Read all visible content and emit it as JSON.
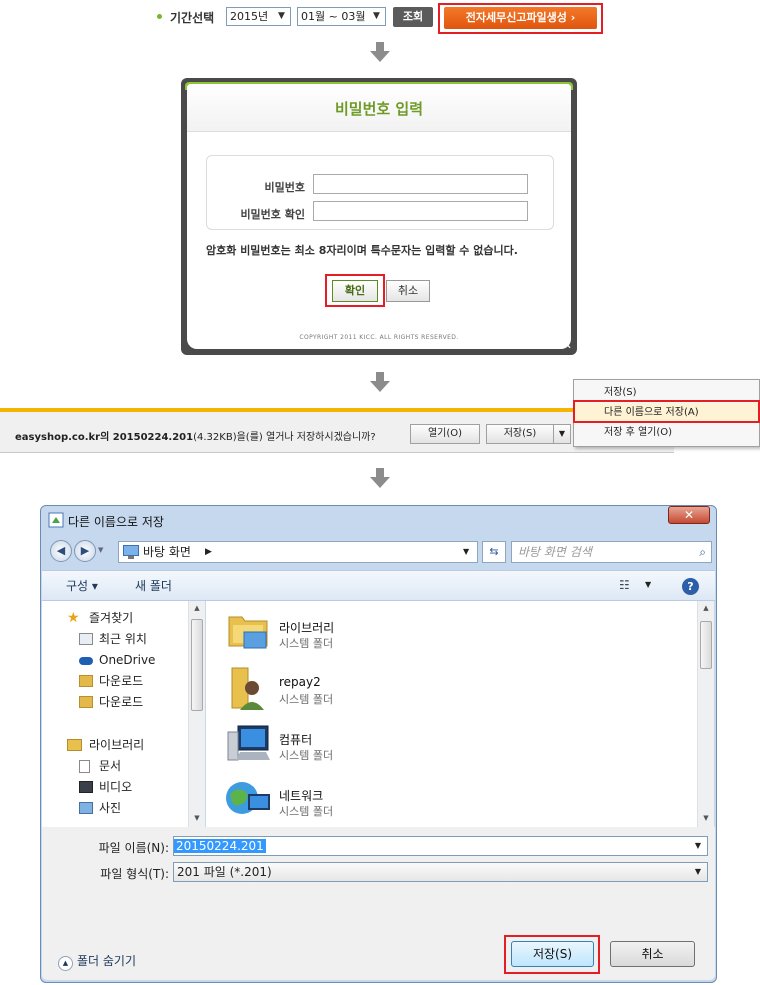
{
  "period_bar": {
    "label": "기간선택",
    "year": "2015년",
    "months": "01월 ~ 03월",
    "search_button": "조회",
    "generate_button": "전자세무신고파일생성 ›"
  },
  "password_dialog": {
    "title": "비밀번호 입력",
    "password_label": "비밀번호",
    "confirm_label": "비밀번호 확인",
    "note": "암호화 비밀번호는 최소 8자리이며 특수문자는 입력할 수 없습니다.",
    "ok_button": "확인",
    "cancel_button": "취소",
    "copyright": "COPYRIGHT 2011 KICC. ALL RIGHTS RESERVED.",
    "close_label": "✕"
  },
  "download_bar": {
    "message_part1": "easyshop.co.kr의 20150224.201",
    "message_part2": "(4.32KB)",
    "message_part3": "을(를) 열거나 저장하시겠습니까?",
    "open_button": "열기(O)",
    "save_button": "저장(S)",
    "menu": [
      "저장(S)",
      "다른 이름으로 저장(A)",
      "저장 후 열기(O)"
    ]
  },
  "save_dialog": {
    "title": "다른 이름으로 저장",
    "address": "바탕 화면",
    "search_placeholder": "바탕 화면 검색",
    "organize": "구성 ▾",
    "new_folder": "새 폴더",
    "nav": {
      "favorites": "즐겨찾기",
      "recent": "최근 위치",
      "onedrive": "OneDrive",
      "downloads1": "다운로드",
      "downloads2": "다운로드",
      "libraries": "라이브러리",
      "documents": "문서",
      "videos": "비디오",
      "pictures": "사진"
    },
    "files": [
      {
        "name": "라이브러리",
        "type": "시스템 폴더"
      },
      {
        "name": "repay2",
        "type": "시스템 폴더"
      },
      {
        "name": "컴퓨터",
        "type": "시스템 폴더"
      },
      {
        "name": "네트워크",
        "type": "시스템 폴더"
      }
    ],
    "filename_label": "파일 이름(N):",
    "filename_value": "20150224.201",
    "filetype_label": "파일 형식(T):",
    "filetype_value": "201 파일 (*.201)",
    "hide_folders": "폴더 숨기기",
    "save_button": "저장(S)",
    "cancel_button": "취소"
  },
  "colors": {
    "accent_red": "#e31e24",
    "orange": "#e8641b",
    "green_title": "#6e9b26",
    "yellow_bar": "#f5b400"
  }
}
